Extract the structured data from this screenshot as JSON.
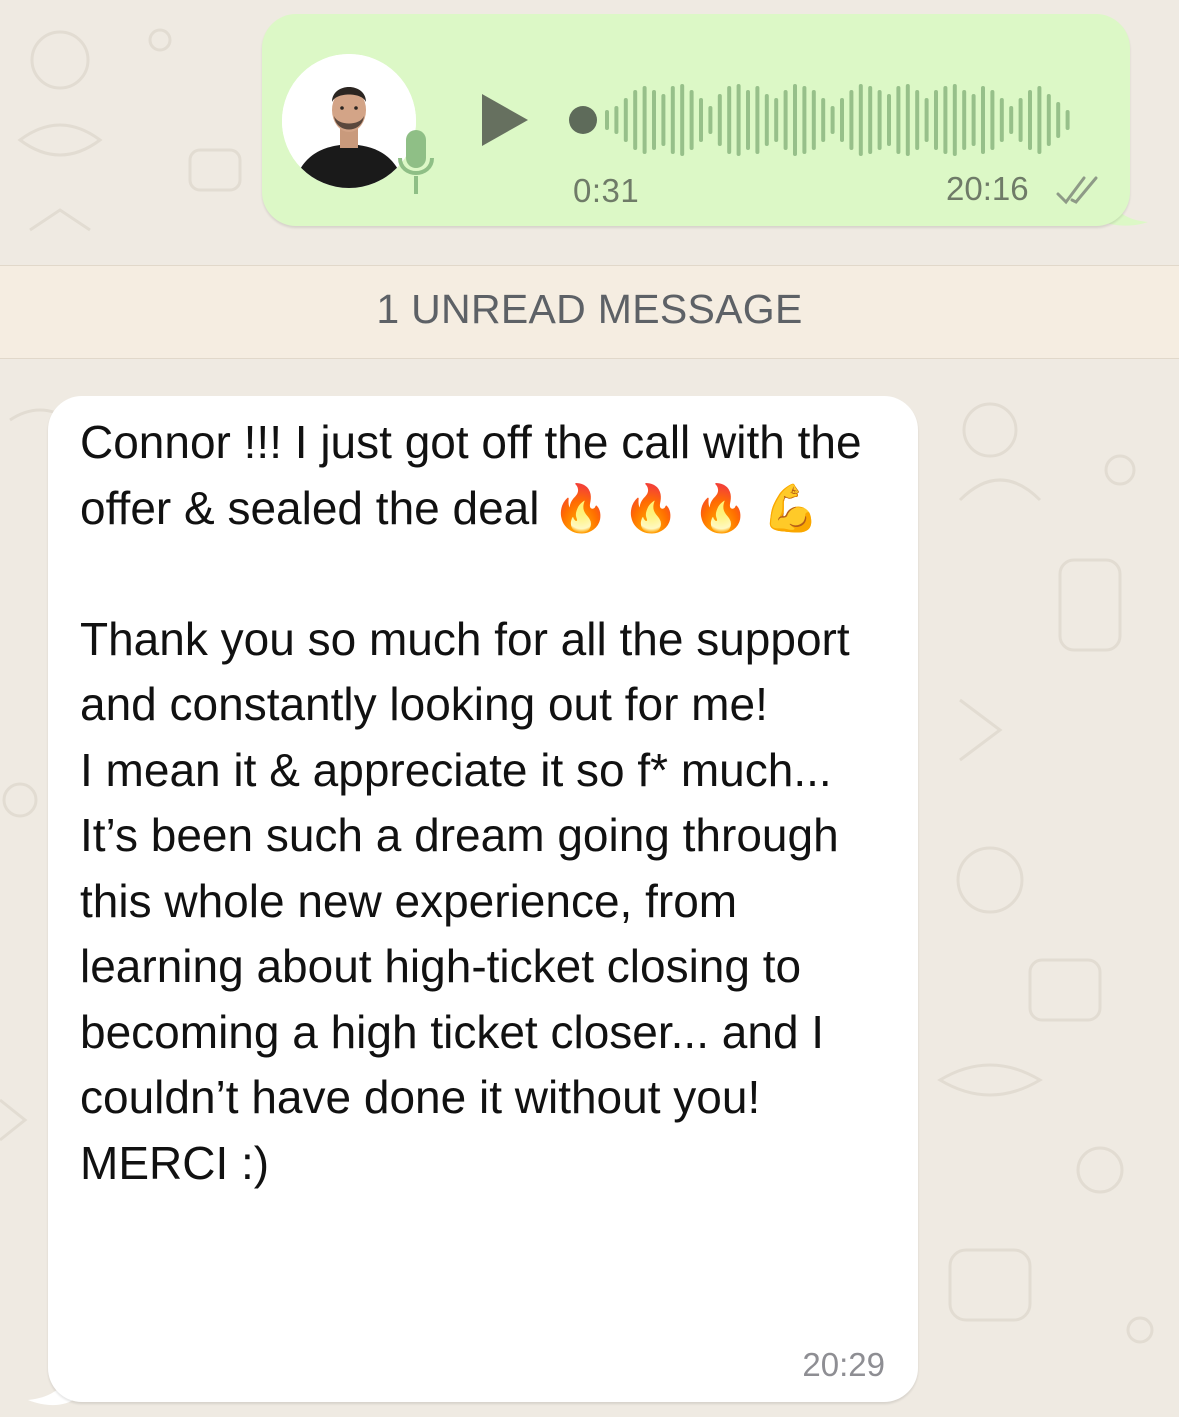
{
  "voice_message": {
    "duration": "0:31",
    "time": "20:16",
    "status": "read",
    "colors": {
      "bubble": "#dcf8c6",
      "waveform": "#97c08a",
      "accent": "#5e6b5a"
    }
  },
  "unread_banner": {
    "text": "1 UNREAD MESSAGE"
  },
  "incoming_message": {
    "text": "Connor !!! I just got off the call with the offer & sealed the deal 🔥 🔥 🔥 💪\n\nThank you so much for all the support and constantly looking out for me!\nI mean it & appreciate it so f* much... It’s been such a dream going through this whole new experience, from learning about high-ticket closing to becoming a high ticket closer... and I couldn’t have done it without you! MERCI :)",
    "time": "20:29"
  },
  "icons": {
    "play": "play-icon",
    "mic": "microphone-icon",
    "read_receipt": "double-check-icon"
  },
  "colors": {
    "chat_background": "#efeae2",
    "incoming_bubble": "#ffffff",
    "banner_background": "#f5ede1",
    "meta_text": "#8e8e93"
  }
}
